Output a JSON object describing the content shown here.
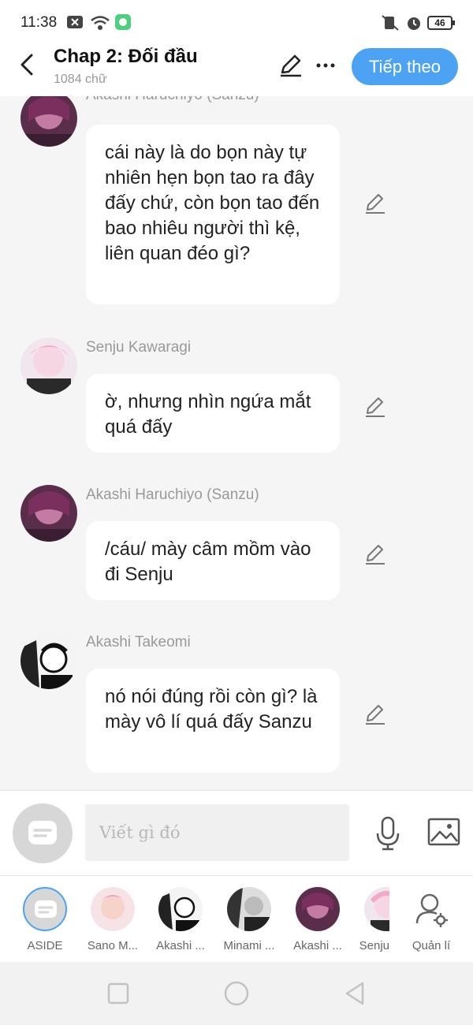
{
  "status_bar": {
    "time": "11:38",
    "battery": "46"
  },
  "header": {
    "title": "Chap 2: Đối đầu",
    "word_count": "1084 chữ",
    "next_label": "Tiếp theo"
  },
  "messages": [
    {
      "sender": "Akashi Haruchiyo (Sanzu)",
      "text": "cái này là do bọn này tự nhiên hẹn bọn tao ra đây đấy chứ, còn bọn tao đến bao nhiêu người thì kệ, liên quan đéo gì?"
    },
    {
      "sender": "Senju Kawaragi",
      "text": "ờ, nhưng nhìn ngứa mắt quá đấy"
    },
    {
      "sender": "Akashi Haruchiyo (Sanzu)",
      "text": "/cáu/ mày câm mồm vào đi Senju"
    },
    {
      "sender": "Akashi Takeomi",
      "text": "nó nói đúng rồi còn gì? là mày vô lí quá đấy Sanzu"
    }
  ],
  "composer": {
    "placeholder": "Viết gì đó"
  },
  "characters": [
    {
      "label": "ASIDE"
    },
    {
      "label": "Sano M..."
    },
    {
      "label": "Akashi ..."
    },
    {
      "label": "Minami ..."
    },
    {
      "label": "Akashi ..."
    },
    {
      "label": "Senju"
    },
    {
      "label": "Quản lí"
    }
  ],
  "colors": {
    "accent": "#4da3f3",
    "background": "#f5f5f5",
    "bubble": "#ffffff"
  }
}
